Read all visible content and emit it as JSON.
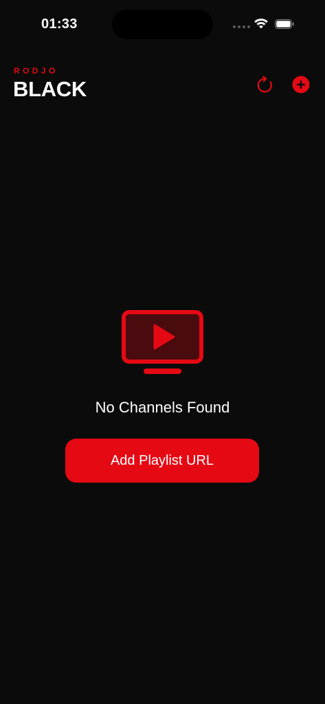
{
  "status_bar": {
    "time": "01:33",
    "icons": [
      "cellular-signal-icon",
      "wifi-icon",
      "battery-icon"
    ]
  },
  "header": {
    "brand_top": "RODJO",
    "brand_main": "BLACK",
    "actions": [
      "refresh-icon",
      "add-circle-icon"
    ]
  },
  "empty_state": {
    "icon": "tv-play-icon",
    "title": "No Channels Found",
    "button_label": "Add Playlist URL"
  },
  "colors": {
    "background": "#0b0b0b",
    "accent": "#e50914",
    "accent_dark": "#4a0b0e",
    "text": "#ffffff"
  }
}
